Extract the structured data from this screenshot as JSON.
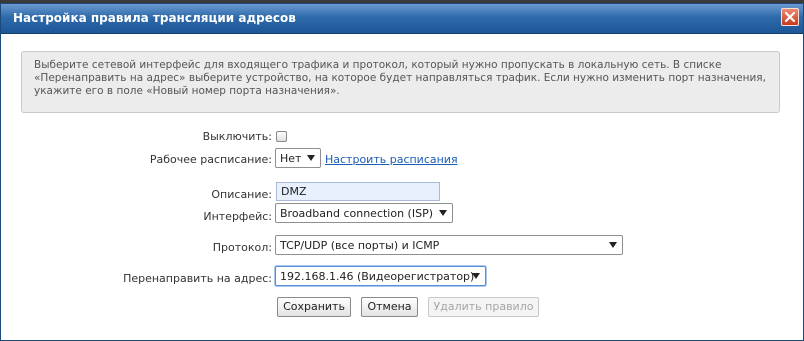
{
  "dialog": {
    "title": "Настройка правила трансляции адресов",
    "description": "Выберите сетевой интерфейс для входящего трафика и протокол, который нужно пропускать в локальную сеть. В списке «Перенаправить на адрес» выберите устройство, на которое будет направляться трафик. Если нужно изменить порт назначения, укажите его в поле «Новый номер порта назначения»."
  },
  "form": {
    "disable": {
      "label": "Выключить:",
      "checked": false
    },
    "schedule": {
      "label": "Рабочее расписание:",
      "value": "Нет",
      "link": "Настроить расписания"
    },
    "description": {
      "label": "Описание:",
      "value": "DMZ"
    },
    "interface": {
      "label": "Интерфейс:",
      "value": "Broadband connection (ISP)"
    },
    "protocol": {
      "label": "Протокол:",
      "value": "TCP/UDP (все порты) и ICMP"
    },
    "redirect": {
      "label": "Перенаправить на адрес:",
      "value": "192.168.1.46 (Видеорегистратор)"
    }
  },
  "buttons": {
    "save": "Сохранить",
    "cancel": "Отмена",
    "delete": "Удалить правило"
  },
  "colors": {
    "titlebar": "#2f6aab",
    "close": "#c63a1c",
    "link": "#1a5db5",
    "focus": "#5b8ed8"
  },
  "icons": {
    "close": "close-icon",
    "caret": "chevron-down-icon"
  }
}
